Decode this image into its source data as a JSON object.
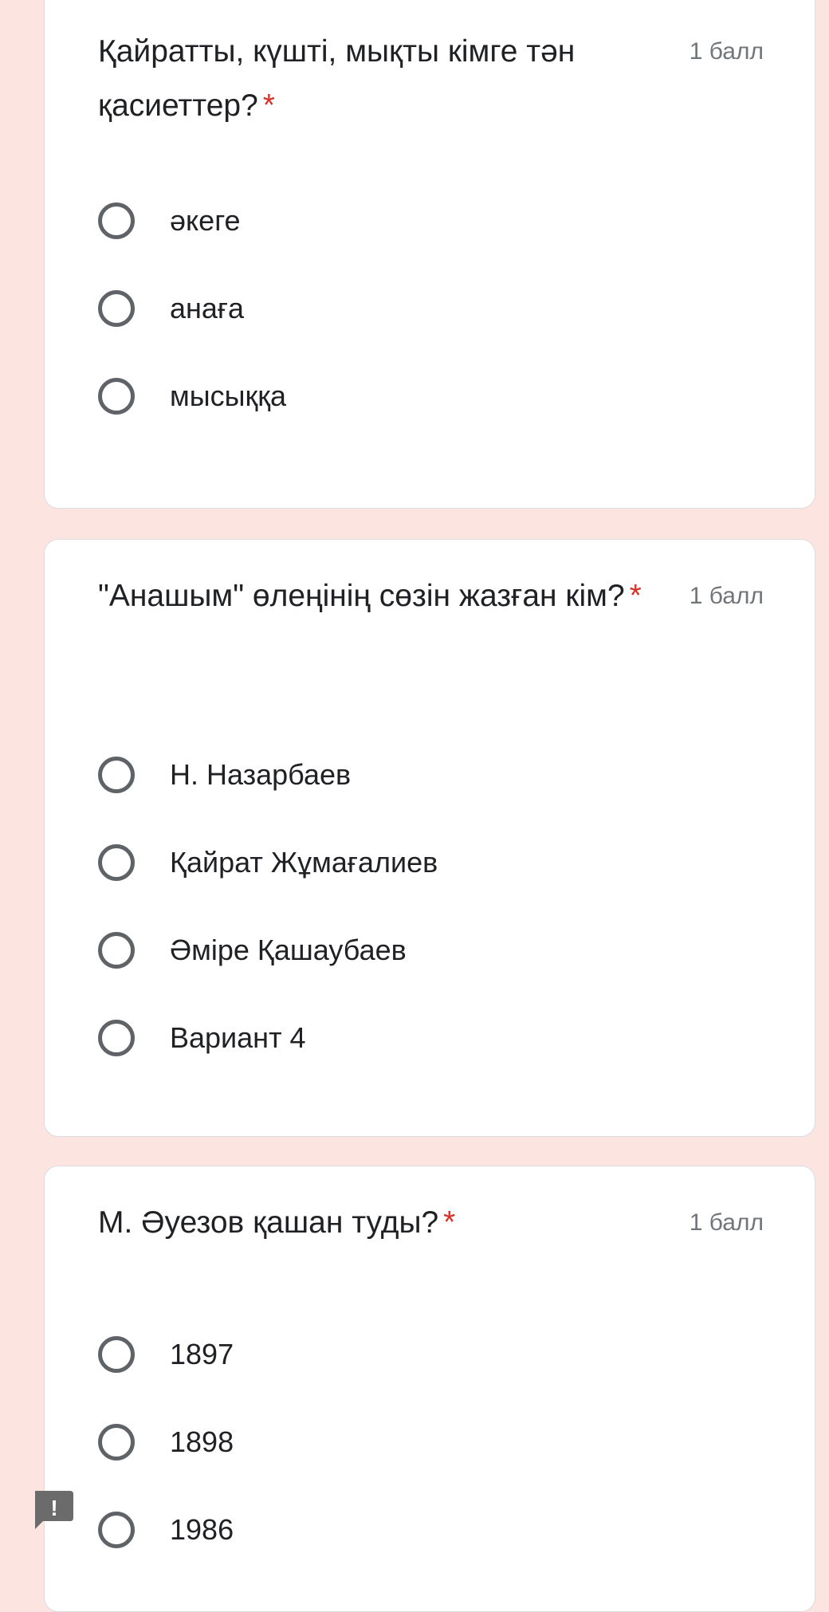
{
  "questions": [
    {
      "text": "Қайратты, күшті, мықты кімге тән қасиеттер?",
      "required_mark": "*",
      "points": "1 балл",
      "options": [
        {
          "label": "әкеге"
        },
        {
          "label": "анаға"
        },
        {
          "label": "мысыққа"
        }
      ]
    },
    {
      "text": "\"Анашым\" өлеңінің сөзін жазған кім?",
      "required_mark": "*",
      "points": "1 балл",
      "options": [
        {
          "label": "Н. Назарбаев"
        },
        {
          "label": "Қайрат Жұмағалиев"
        },
        {
          "label": "Әміре Қашаубаев"
        },
        {
          "label": "Вариант 4"
        }
      ]
    },
    {
      "text": "М. Әуезов қашан туды?",
      "required_mark": "*",
      "points": "1 балл",
      "options": [
        {
          "label": "1897"
        },
        {
          "label": "1898"
        },
        {
          "label": "1986"
        }
      ]
    }
  ],
  "feedback": {
    "icon": "report-feedback-icon",
    "glyph": "!"
  },
  "colors": {
    "background": "#fce4e1",
    "card": "#ffffff",
    "required": "#d93025",
    "radio_border": "#5f6368",
    "text": "#202124",
    "points": "#70757a"
  }
}
